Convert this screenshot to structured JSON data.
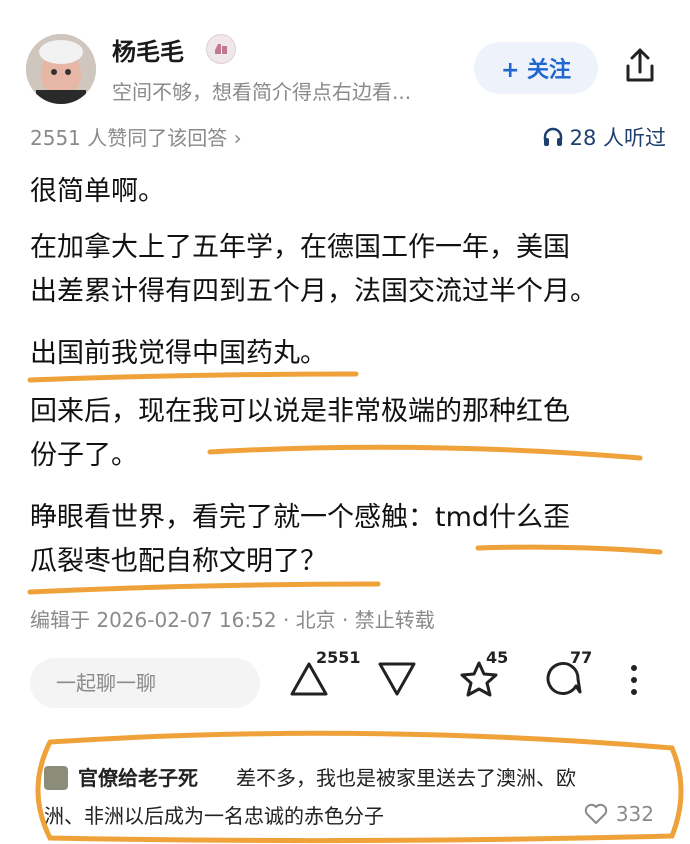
{
  "header": {
    "username": "杨毛毛",
    "bio": "空间不够，想看简介得点右边看...",
    "follow_label": "+ 关注"
  },
  "meta": {
    "likes_text": "2551 人赞同了该回答 ›",
    "listeners_text": "28 人听过"
  },
  "content": {
    "paragraphs": [
      [
        "很简单啊。"
      ],
      [
        "在加拿大上了五年学，在德国工作一年，美国",
        "出差累计得有四到五个月，法国交流过半个月。"
      ],
      [
        "出国前我觉得中国药丸。"
      ],
      [
        "回来后，现在我可以说是非常极端的那种红色",
        "份子了。"
      ],
      [
        "睁眼看世界，看完了就一个感触：tmd什么歪",
        "瓜裂枣也配自称文明了？"
      ]
    ],
    "edit_info": "编辑于 2026-02-07 16:52 · 北京 · 禁止转载"
  },
  "actions": {
    "chat_placeholder": "一起聊一聊",
    "upvote_count": "2551",
    "star_count": "45",
    "comment_count": "77"
  },
  "comment": {
    "name": "官僚给老子死",
    "text_line1": "差不多，我也是被家里送去了澳洲、欧",
    "text_line2": "洲、非洲以后成为一名忠诚的赤色分子",
    "likes": "332"
  },
  "colors": {
    "accent_blue": "#1f66d1",
    "highlight_orange": "#f0a23a"
  }
}
